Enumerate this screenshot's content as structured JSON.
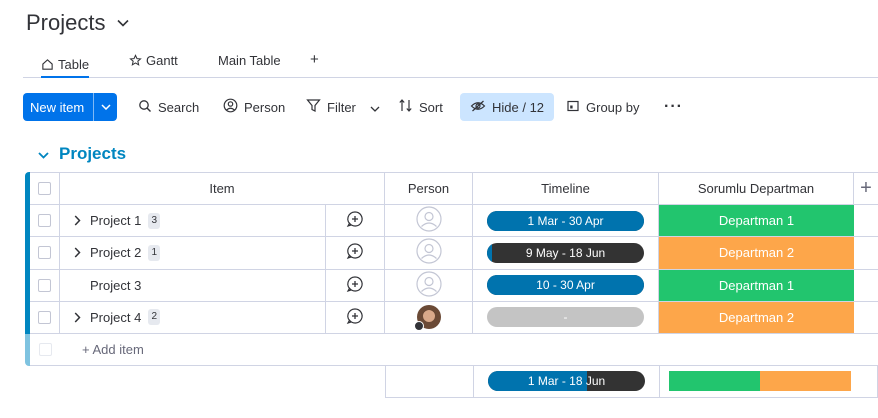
{
  "page": {
    "title": "Projects"
  },
  "view_tabs": [
    {
      "label": "Table",
      "icon": "home-icon",
      "active": true
    },
    {
      "label": "Gantt",
      "icon": "star-icon",
      "active": false
    },
    {
      "label": "Main Table",
      "icon": "",
      "active": false
    },
    {
      "label": "+",
      "icon": "",
      "active": false
    }
  ],
  "toolbar": {
    "new_item": "New item",
    "search": "Search",
    "person": "Person",
    "filter": "Filter",
    "sort": "Sort",
    "hide": "Hide / 12",
    "group_by": "Group by",
    "more": "···"
  },
  "group": {
    "title": "Projects",
    "color": "#0086c0"
  },
  "columns": {
    "item": "Item",
    "person": "Person",
    "timeline": "Timeline",
    "department": "Sorumlu Departman",
    "add": "+"
  },
  "rows": [
    {
      "name": "Project 1",
      "subitems": "3",
      "expandable": true,
      "person": "empty",
      "timeline": "1 Mar - 30 Apr",
      "timeline_progress": 1.0,
      "department": "Departman 1",
      "department_color": "#22c56e"
    },
    {
      "name": "Project 2",
      "subitems": "1",
      "expandable": true,
      "person": "empty",
      "timeline": "9 May - 18 Jun",
      "timeline_progress": 0.03,
      "department": "Departman 2",
      "department_color": "#fda64a"
    },
    {
      "name": "Project 3",
      "subitems": "",
      "expandable": false,
      "person": "empty",
      "timeline": "10 - 30 Apr",
      "timeline_progress": 1.0,
      "department": "Departman 1",
      "department_color": "#22c56e"
    },
    {
      "name": "Project 4",
      "subitems": "2",
      "expandable": true,
      "person": "avatar",
      "timeline": "-",
      "timeline_progress": 0,
      "department": "Departman 2",
      "department_color": "#fda64a"
    }
  ],
  "add_item": "+ Add item",
  "summary": {
    "timeline": "1 Mar - 18 Jun",
    "timeline_progress": 0.63,
    "department_split": [
      {
        "label": "Departman 1",
        "fraction": 0.5,
        "color": "#22c56e"
      },
      {
        "label": "Departman 2",
        "fraction": 0.5,
        "color": "#fda64a"
      }
    ]
  },
  "colors": {
    "accent": "#0073ea",
    "timeline_fill": "#0073ae",
    "timeline_rest": "#333333",
    "timeline_empty": "#c4c4c4",
    "hide_bg": "#cce5ff"
  }
}
